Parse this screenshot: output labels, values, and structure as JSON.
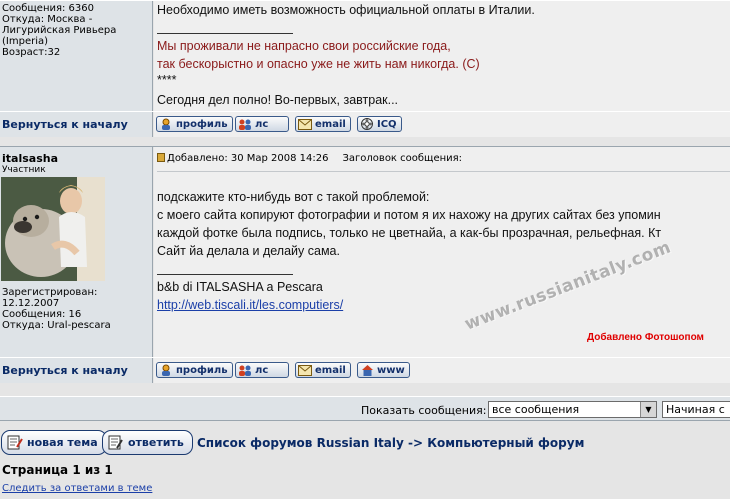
{
  "post1": {
    "author_info": [
      "Сообщения: 6360",
      "Откуда: Москва -",
      "Лигурийская Ривьера",
      "(Imperia)",
      "Возраст:32"
    ],
    "lines": [
      {
        "text": "Необходимо иметь возможность официальной оплаты в Италии.",
        "red": false
      },
      {
        "text": "Мы проживали не напрасно свои российские года,",
        "red": true
      },
      {
        "text": "так бескорыстно и опасно уже не жить нам никогда. (С)",
        "red": true
      },
      {
        "text": "****",
        "red": false
      },
      {
        "text": "Сегодня дел полно! Во-первых, завтрак...",
        "red": false
      }
    ]
  },
  "nav": {
    "back_to_top": "Вернуться к началу"
  },
  "buttons": {
    "profile": "профиль",
    "pm": "лс",
    "email": "email",
    "icq": "ICQ",
    "www": "www"
  },
  "post2": {
    "username": "italsasha",
    "rank": "Участник",
    "author_info": [
      "Зарегистрирован:",
      "12.12.2007",
      "Сообщения: 16",
      "Откуда: Ural-pescara"
    ],
    "posted": "Добавлено: 30 Мар 2008 14:26",
    "subject_label": "Заголовок сообщения:",
    "lines": [
      "подскажите кто-нибудь вот с такой проблемой:",
      "с моего сайта копируют фотографии и потом я их нахожу на других сайтах без упомин",
      "каждой фотке была подпись, только не цветнайа, а как-бы прозрачная, рельефная. Кт",
      "Сайт йа делала и делайу сама."
    ],
    "signature": "b&b di ITALSASHA a Pescara",
    "signature_link": "http://web.tiscali.it/les.computiers/",
    "credit": "Добавлено Фотошопом",
    "watermark": "www.russianitaly.com"
  },
  "controls": {
    "label": "Показать сообщения:",
    "filter_value": "все сообщения",
    "order_value": "Начиная с"
  },
  "footer": {
    "new_topic": "новая тема",
    "reply": "ответить",
    "breadcrumb": "Список форумов Russian Italy -> Компьютерный форум",
    "page_info": "Страница 1 из 1",
    "watch_link": "Следить за ответами в теме"
  }
}
